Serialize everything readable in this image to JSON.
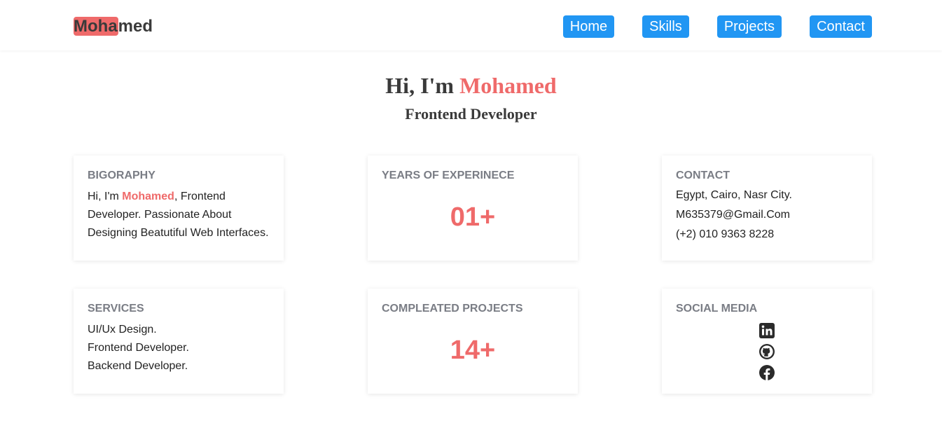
{
  "header": {
    "logo_part1": "Moha",
    "logo_part2": "med",
    "nav": [
      "Home",
      "Skills",
      "Projects",
      "Contact"
    ]
  },
  "hero": {
    "greeting": "Hi, I'm ",
    "name": "Mohamed",
    "subtitle": "Frontend Developer"
  },
  "cards": {
    "biography": {
      "title": "BIGORAPHY",
      "text_before": "Hi, I'm ",
      "name": "Mohamed",
      "text_after": ", Frontend Developer. Passionate About Designing Beatutiful Web Interfaces."
    },
    "experience": {
      "title": "YEARS OF EXPERINECE",
      "value": "01+"
    },
    "contact": {
      "title": "CONTACT",
      "lines": [
        "Egypt, Cairo, Nasr City.",
        "M635379@Gmail.Com",
        "(+2) 010 9363 8228"
      ]
    },
    "services": {
      "title": "SERVICES",
      "lines": [
        "UI/Ux Design.",
        "Frontend Developer.",
        "Backend Developer."
      ]
    },
    "projects": {
      "title": "COMPLEATED PROJECTS",
      "value": "14+"
    },
    "social": {
      "title": "SOCIAL MEDIA",
      "icons": [
        "linkedin-icon",
        "github-icon",
        "facebook-icon"
      ]
    }
  },
  "colors": {
    "accent": "#ef6a6a",
    "nav_button": "#2196f3",
    "card_title": "#7a7d85"
  }
}
